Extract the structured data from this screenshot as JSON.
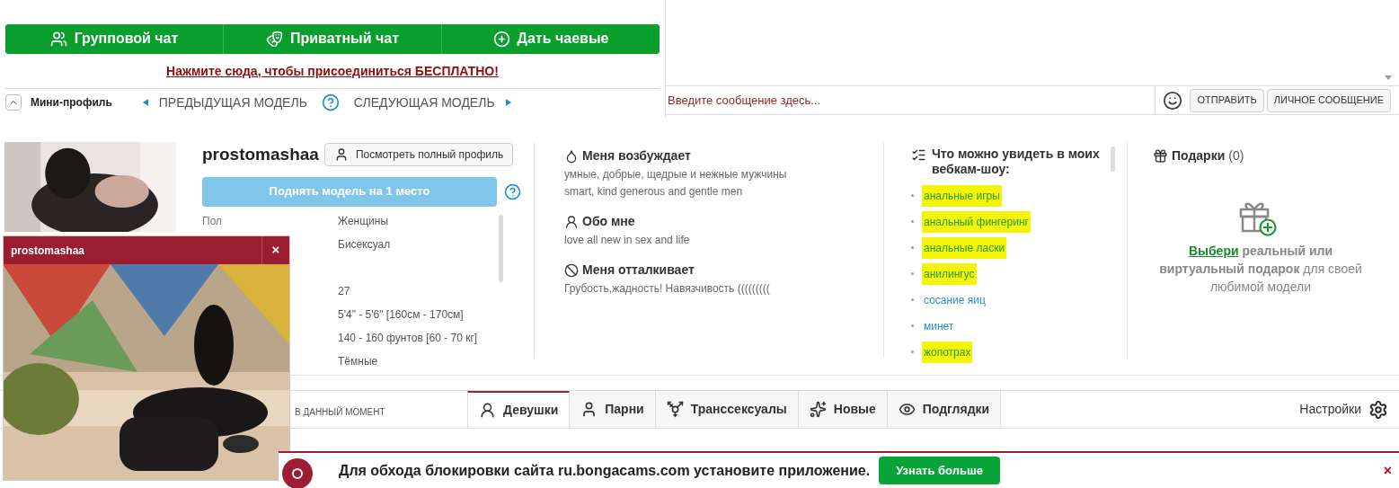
{
  "actions": [
    {
      "kind": "group",
      "label": "Групповой чат"
    },
    {
      "kind": "private",
      "label": "Приватный чат"
    },
    {
      "kind": "tip",
      "label": "Дать чаевые"
    }
  ],
  "join_link": "Нажмите сюда, чтобы присоединиться БЕСПЛАТНО!",
  "nav": {
    "mini_profile": "Мини-профиль",
    "expanded": true,
    "prev": "ПРЕДЫДУЩАЯ МОДЕЛЬ",
    "next": "СЛЕДУЮЩАЯ МОДЕЛЬ"
  },
  "chat": {
    "placeholder": "Введите сообщение здесь...",
    "send": "ОТПРАВИТЬ",
    "private_message": "ЛИЧНОЕ СООБЩЕНИЕ"
  },
  "profile": {
    "name": "prostomashaa",
    "full_profile": "Посмотреть полный профиль",
    "boost": "Поднять модель на 1 место",
    "fields": [
      {
        "label": "Пол",
        "value": "Женщины"
      },
      {
        "value": "Бисексуал"
      },
      {
        "value": "27"
      },
      {
        "value": "5'4\" - 5'6\" [160см - 170см]"
      },
      {
        "value": "140 - 160 фунтов [60 - 70 кг]"
      },
      {
        "value": "Тёмные"
      }
    ]
  },
  "about": [
    {
      "kind": "likes",
      "title": "Меня возбуждает",
      "lines": [
        "умные, добрые, щедрые и нежные мужчины",
        "smart, kind generous and gentle men"
      ]
    },
    {
      "kind": "about",
      "title": "Обо мне",
      "lines": [
        "love all new in sex and life"
      ]
    },
    {
      "kind": "dislikes",
      "title": "Меня отталкивает",
      "lines": [
        "Грубость,жадность! Навязчивость ((((((((("
      ]
    }
  ],
  "shows": {
    "title": "Что можно увидеть в моих вебкам-шоу:",
    "items": [
      {
        "label": "анальные игры",
        "highlighted": true
      },
      {
        "label": "анальный фингеринг",
        "highlighted": true
      },
      {
        "label": "анальные ласки",
        "highlighted": true
      },
      {
        "label": "анилингус",
        "highlighted": true
      },
      {
        "label": "сосание яиц",
        "highlighted": false
      },
      {
        "label": "минет",
        "highlighted": false
      },
      {
        "label": "жопотрах",
        "highlighted": true
      }
    ]
  },
  "gifts": {
    "title": "Подарки",
    "count": "(0)",
    "link": "Выбери",
    "text": "**реальный или виртуальный подарок** для своей любимой модели"
  },
  "tabs_bar": {
    "caption": "В ДАННЫЙ МОМЕНТ",
    "tabs": [
      {
        "kind": "female",
        "label": "Девушки",
        "selected": true
      },
      {
        "kind": "male",
        "label": "Парни",
        "selected": false
      },
      {
        "kind": "trans",
        "label": "Транссексуалы",
        "selected": false
      },
      {
        "kind": "new",
        "label": "Новые",
        "selected": false
      },
      {
        "kind": "peek",
        "label": "Подглядки",
        "selected": false
      }
    ],
    "settings": "Настройки"
  },
  "mini_player": {
    "title": "prostomashaa",
    "close": "×"
  },
  "banner": {
    "text": "Для обхода блокировки сайта ru.bongacams.com установите приложение.",
    "button": "Узнать больше",
    "close": "×"
  }
}
